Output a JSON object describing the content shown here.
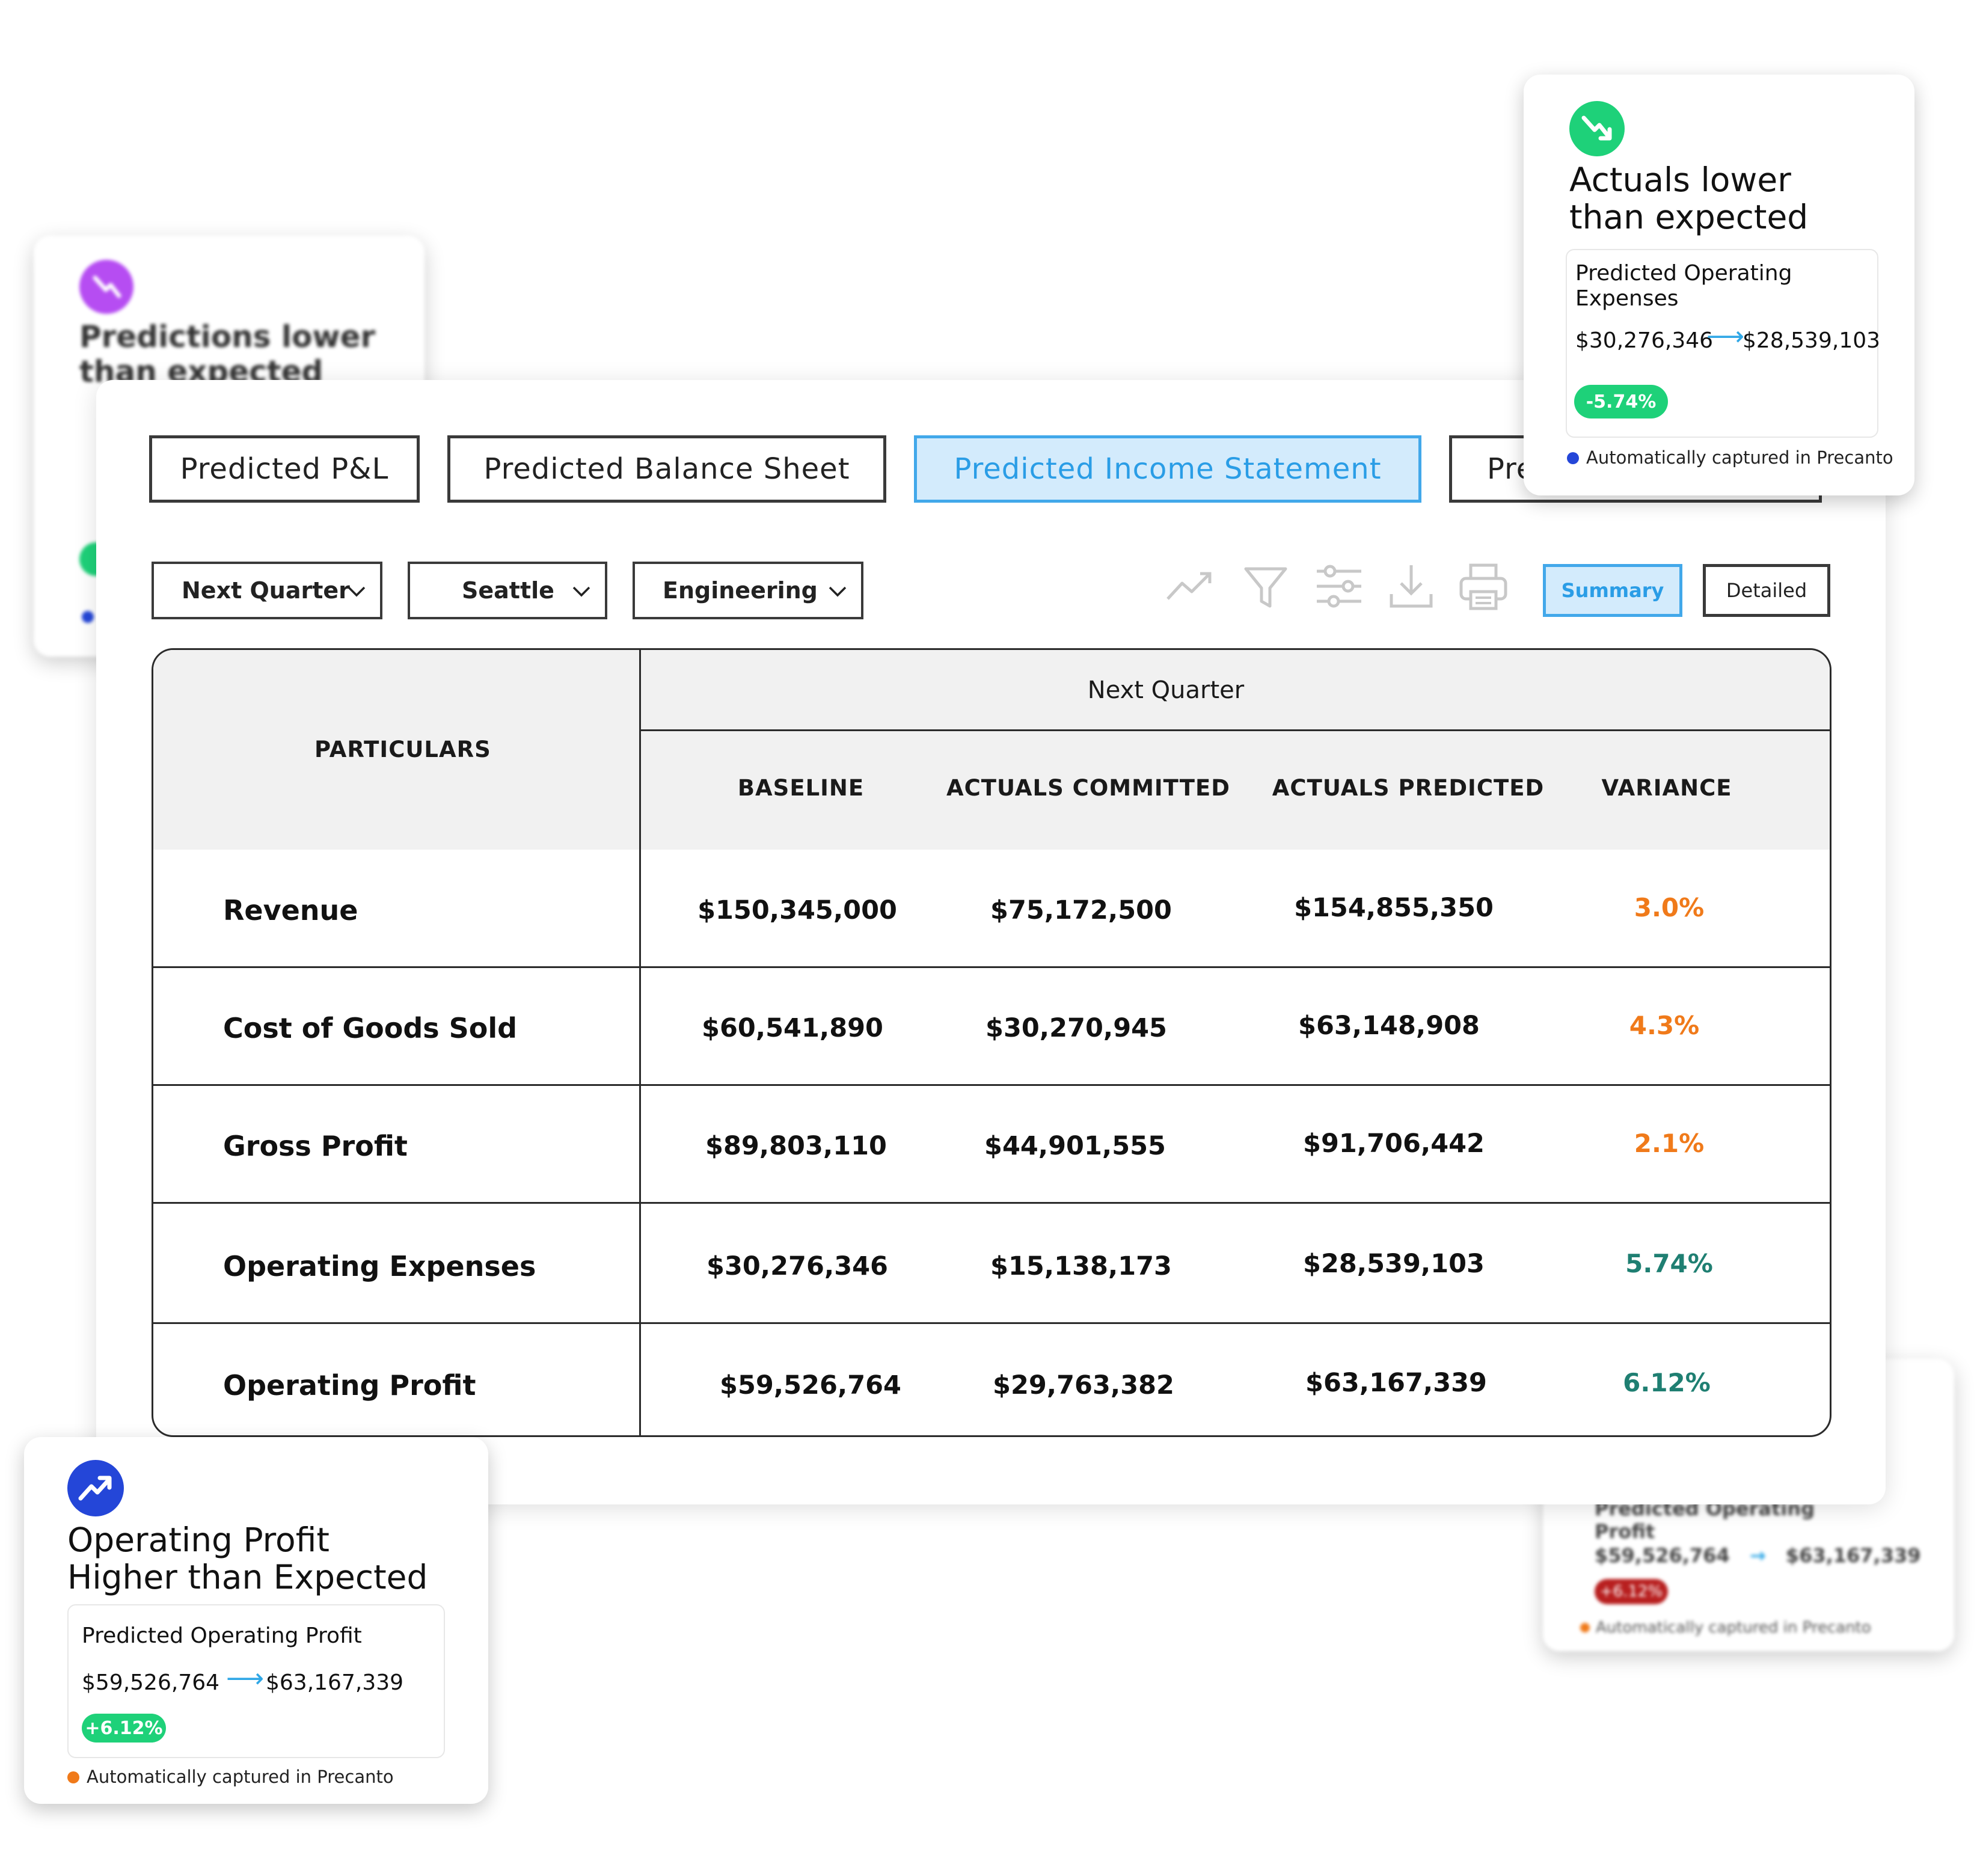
{
  "colors": {
    "accent_blue": "#2a9de6",
    "accent_blue_bg": "#d3ebfc",
    "variance_orange": "#f07a1a",
    "variance_green": "#1f7f72",
    "badge_green": "#1ed179",
    "icon_green": "#1ed179",
    "icon_blue": "#2446d8",
    "icon_purple": "#b64df2"
  },
  "bg_card_left": {
    "title": "Predictions lower than expected",
    "icon": "trend-down-icon"
  },
  "tabs": [
    {
      "label": "Predicted P&L",
      "active": false
    },
    {
      "label": "Predicted Balance Sheet",
      "active": false
    },
    {
      "label": "Predicted Income Statement",
      "active": true
    },
    {
      "label": "Pre",
      "active": false
    }
  ],
  "filters": {
    "period": "Next Quarter",
    "location": "Seattle",
    "department": "Engineering"
  },
  "toolbar": {
    "icons": [
      "trend-icon",
      "filter-icon",
      "sliders-icon",
      "download-icon",
      "print-icon"
    ],
    "summary_label": "Summary",
    "detailed_label": "Detailed"
  },
  "table": {
    "particulars_header": "PARTICULARS",
    "period_header": "Next Quarter",
    "columns": [
      "BASELINE",
      "ACTUALS COMMITTED",
      "ACTUALS PREDICTED",
      "VARIANCE"
    ],
    "rows": [
      {
        "label": "Revenue",
        "baseline": "$150,345,000",
        "committed": "$75,172,500",
        "predicted": "$154,855,350",
        "variance": "3.0%",
        "variance_color": "#f07a1a"
      },
      {
        "label": "Cost of Goods Sold",
        "baseline": "$60,541,890",
        "committed": "$30,270,945",
        "predicted": "$63,148,908",
        "variance": "4.3%",
        "variance_color": "#f07a1a"
      },
      {
        "label": "Gross Profit",
        "baseline": "$89,803,110",
        "committed": "$44,901,555",
        "predicted": "$91,706,442",
        "variance": "2.1%",
        "variance_color": "#f07a1a"
      },
      {
        "label": "Operating Expenses",
        "baseline": "$30,276,346",
        "committed": "$15,138,173",
        "predicted": "$28,539,103",
        "variance": "5.74%",
        "variance_color": "#1f7f72"
      },
      {
        "label": "Operating Profit",
        "baseline": "$59,526,764",
        "committed": "$29,763,382",
        "predicted": "$63,167,339",
        "variance": "6.12%",
        "variance_color": "#1f7f72"
      }
    ]
  },
  "card_top_right": {
    "icon": "trend-down-icon",
    "title_line1": "Actuals lower",
    "title_line2": "than expected",
    "metric_line1": "Predicted Operating",
    "metric_line2": "Expenses",
    "from_value": "$30,276,346",
    "to_value": "$28,539,103",
    "badge": "-5.74%",
    "footer": "Automatically captured in Precanto",
    "footer_dot_color": "#2446d8"
  },
  "card_bottom_left": {
    "icon": "trend-up-icon",
    "title_line1": "Operating Profit",
    "title_line2": "Higher than Expected",
    "metric": "Predicted Operating Profit",
    "from_value": "$59,526,764",
    "to_value": "$63,167,339",
    "badge": "+6.12%",
    "footer": "Automatically captured in Precanto",
    "footer_dot_color": "#f07a1a"
  },
  "bg_card_bottom_right": {
    "metric_line1": "Predicted Operating",
    "metric_line2": "Profit",
    "from_value": "$59,526,764",
    "to_value": "$63,167,339",
    "badge": "+6.12%",
    "footer": "Automatically captured in Precanto"
  }
}
